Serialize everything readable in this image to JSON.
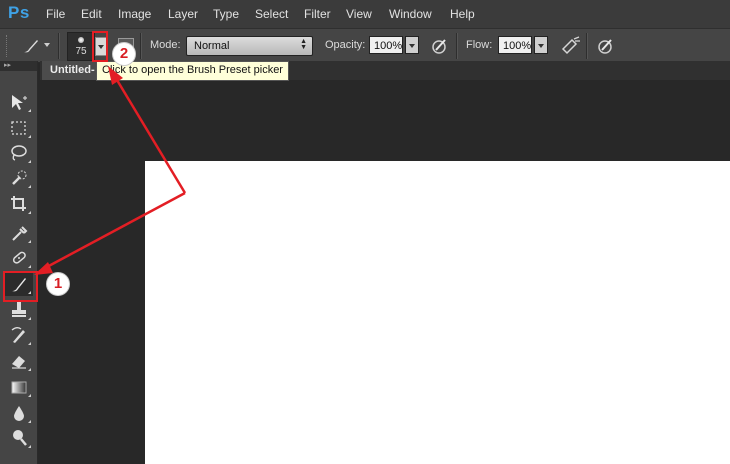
{
  "app": {
    "logo_text": "Ps",
    "accent_color": "#3fa2e6"
  },
  "menu": [
    {
      "label": "File"
    },
    {
      "label": "Edit"
    },
    {
      "label": "Image"
    },
    {
      "label": "Layer"
    },
    {
      "label": "Type"
    },
    {
      "label": "Select"
    },
    {
      "label": "Filter"
    },
    {
      "label": "View"
    },
    {
      "label": "Window"
    },
    {
      "label": "Help"
    }
  ],
  "options_bar": {
    "brush_size": "75",
    "mode_label": "Mode:",
    "mode_value": "Normal",
    "opacity_label": "Opacity:",
    "opacity_value": "100%",
    "flow_label": "Flow:",
    "flow_value": "100%"
  },
  "document_tab": {
    "title": "Untitled-"
  },
  "tooltip": {
    "text": "Click to open the Brush Preset picker"
  },
  "tools": [
    "move-tool-icon",
    "marquee-tool-icon",
    "lasso-tool-icon",
    "quick-selection-tool-icon",
    "crop-tool-icon",
    "eyedropper-tool-icon",
    "healing-brush-tool-icon",
    "brush-tool-icon",
    "clone-stamp-tool-icon",
    "history-brush-tool-icon",
    "eraser-tool-icon",
    "gradient-tool-icon",
    "blur-tool-icon",
    "dodge-tool-icon"
  ],
  "annotations": {
    "callout_1": "1",
    "callout_2": "2",
    "highlight_color": "#e31e24"
  }
}
